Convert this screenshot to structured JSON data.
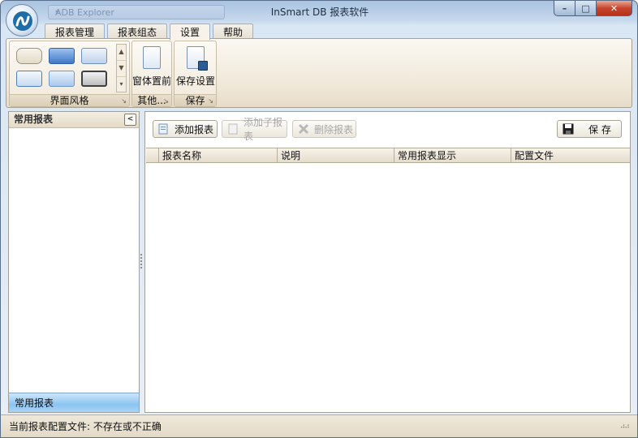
{
  "window": {
    "title": "InSmart DB 报表软件",
    "quick_access_placeholder": "ADB Explorer",
    "minimize_glyph": "–",
    "maximize_glyph": "□",
    "close_glyph": "✕"
  },
  "ribbon": {
    "tabs": [
      {
        "label": "报表管理"
      },
      {
        "label": "报表组态"
      },
      {
        "label": "设置"
      },
      {
        "label": "帮助"
      }
    ],
    "active_tab": "设置",
    "groups": {
      "style": {
        "label": "界面风格"
      },
      "other": {
        "label": "其他...",
        "button": "窗体置前"
      },
      "save": {
        "label": "保存",
        "button": "保存设置"
      }
    }
  },
  "left_pane": {
    "header": "常用报表",
    "collapse_glyph": "<",
    "footer_item": "常用报表"
  },
  "main_pane": {
    "toolbar": {
      "add_report": "添加报表",
      "add_sub_report": "添加子报表",
      "delete_report": "删除报表",
      "save": "保 存"
    },
    "grid": {
      "columns": [
        "报表名称",
        "说明",
        "常用报表显示",
        "配置文件"
      ],
      "rows": []
    }
  },
  "status": {
    "text": "当前报表配置文件: 不存在或不正确"
  },
  "colors": {
    "accent": "#8cc4f1",
    "close_button": "#c7452c",
    "ribbon_bg": "#efe7d8"
  }
}
